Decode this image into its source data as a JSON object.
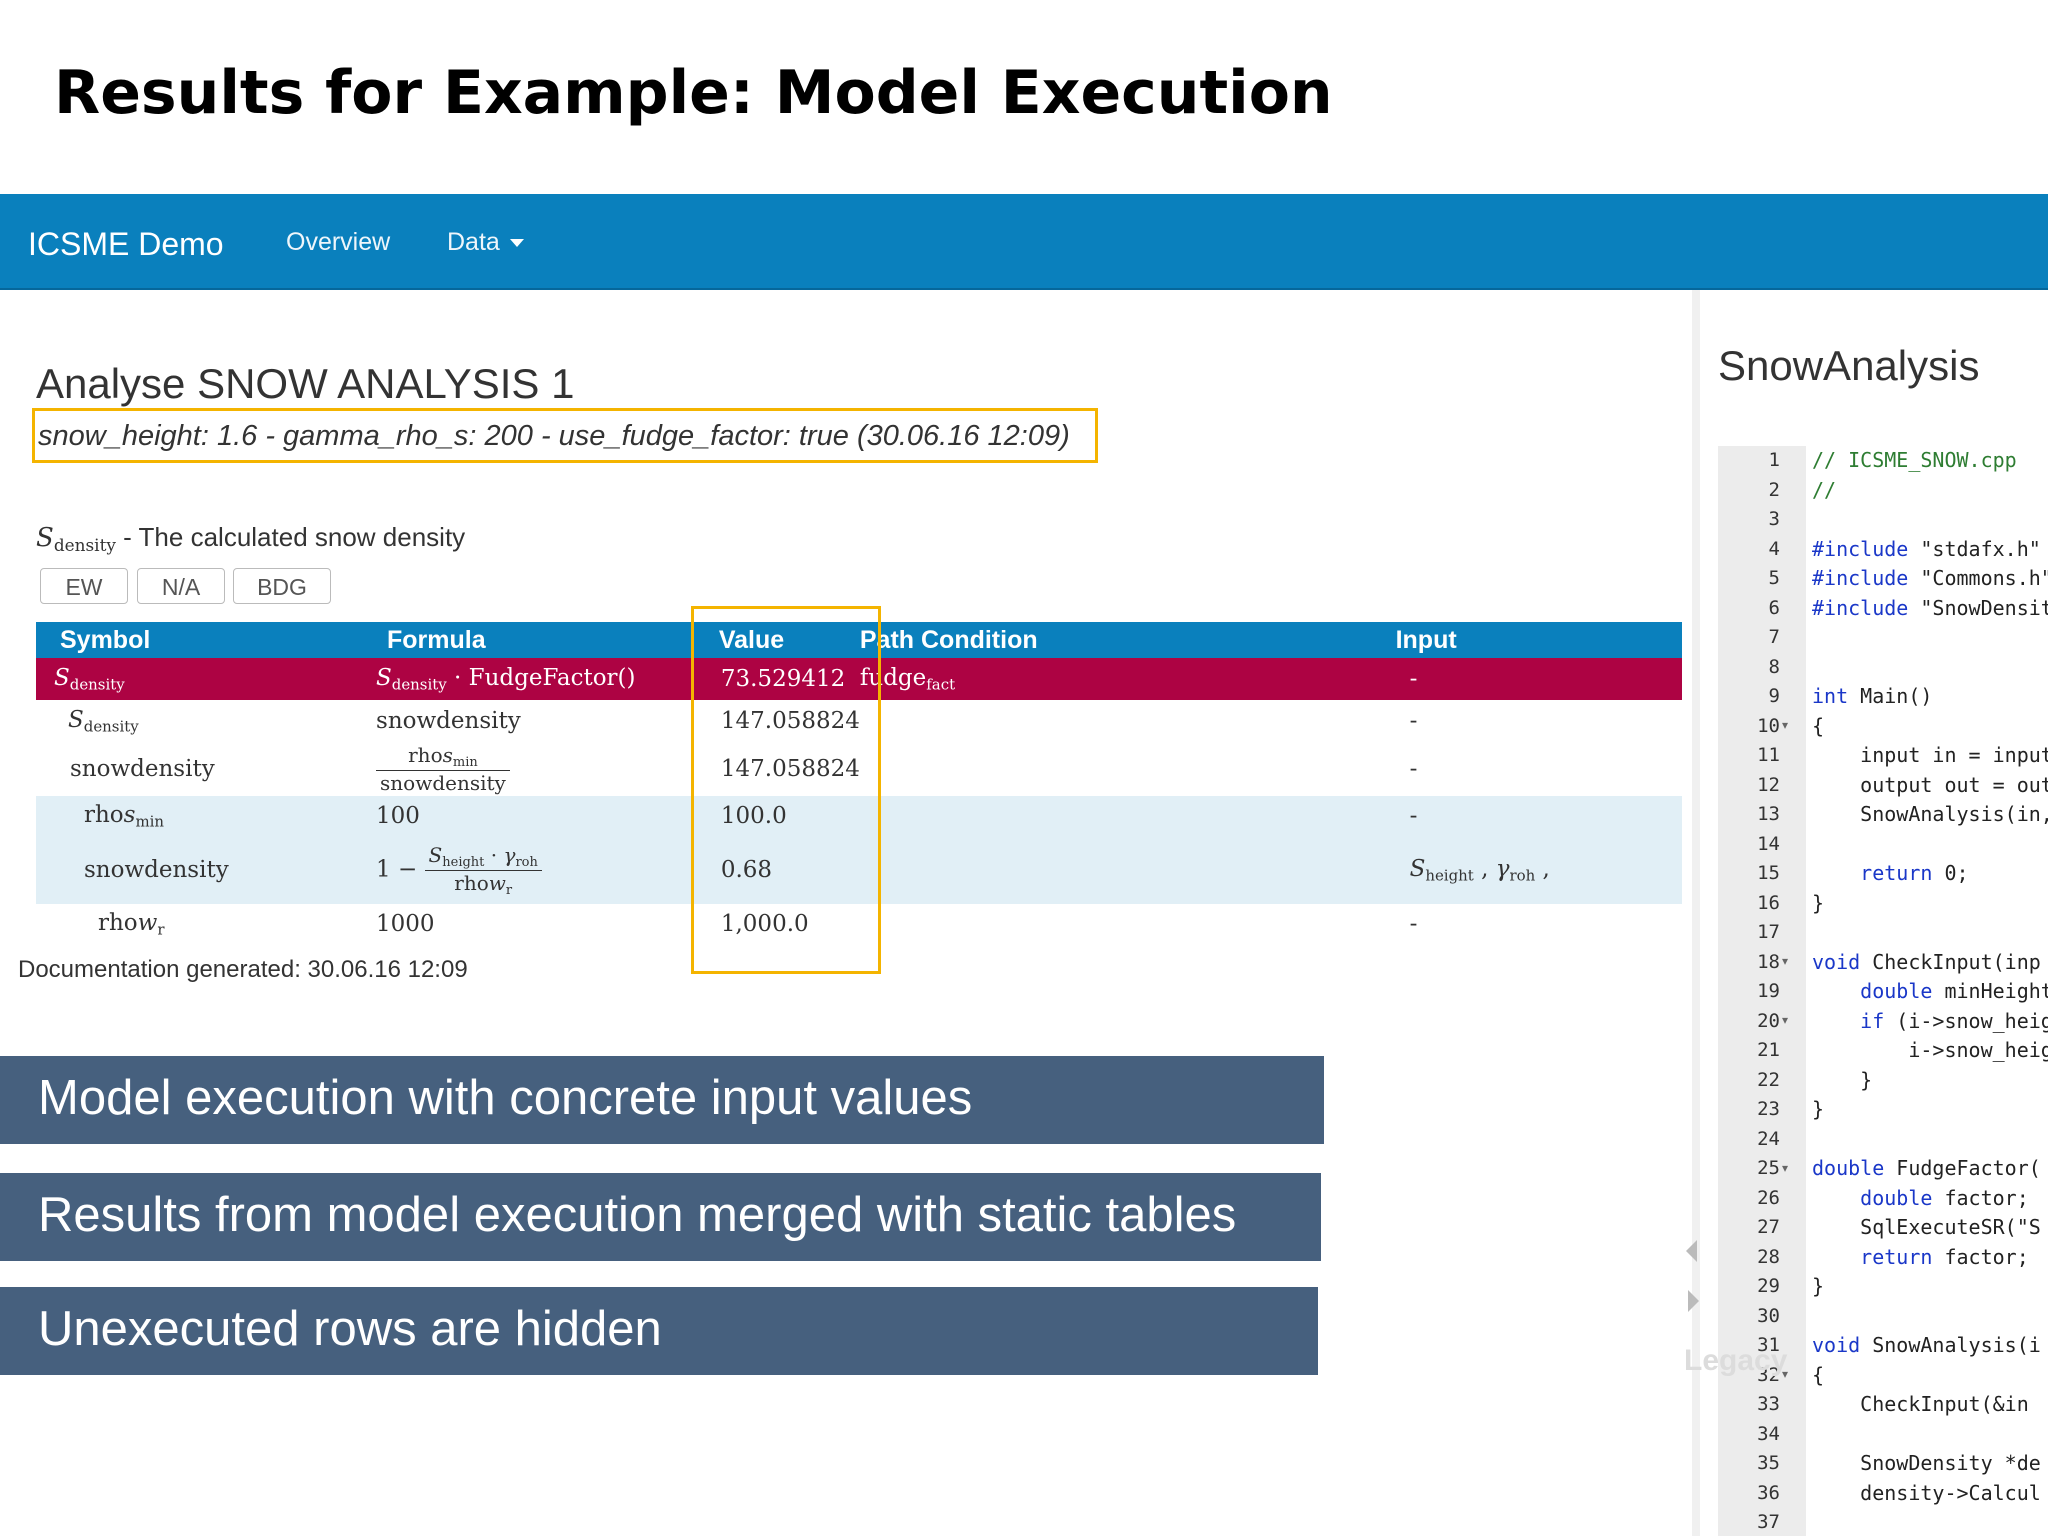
{
  "slide": {
    "title": "Results for Example: Model Execution"
  },
  "navbar": {
    "brand": "ICSME Demo",
    "items": [
      "Overview",
      "Data"
    ]
  },
  "analysis": {
    "title": "Analyse SNOW ANALYSIS 1",
    "params": "snow_height: 1.6 - gamma_rho_s: 200 - use_fudge_factor: true (30.06.16 12:09)",
    "symbol_desc": "- The calculated snow density",
    "buttons": [
      "EW",
      "N/A",
      "BDG"
    ]
  },
  "table": {
    "headers": [
      "Symbol",
      "Formula",
      "Value",
      "Path Condition",
      "Input"
    ],
    "rows": [
      {
        "value": "73.529412",
        "input": "-"
      },
      {
        "formula": "snowdensity",
        "value": "147.058824",
        "input": "-"
      },
      {
        "symbol": "snowdensity",
        "value": "147.058824",
        "input": "-",
        "frac_den": "snowdensity"
      },
      {
        "formula": "100",
        "value": "100.0",
        "input": "-"
      },
      {
        "symbol": "snowdensity",
        "value": "0.68"
      },
      {
        "formula": "1000",
        "value": "1,000.0",
        "input": "-"
      }
    ]
  },
  "doc_generated": "Documentation generated: 30.06.16 12:09",
  "banners": [
    "Model execution with concrete input values",
    "Results from model execution merged with static tables",
    "Unexecuted rows are hidden"
  ],
  "code_panel": {
    "title": "SnowAnalysis",
    "lines": [
      "1",
      "2",
      "3",
      "4",
      "5",
      "6",
      "7",
      "8",
      "9",
      "10",
      "11",
      "12",
      "13",
      "14",
      "15",
      "16",
      "17",
      "18",
      "19",
      "20",
      "21",
      "22",
      "23",
      "24",
      "25",
      "26",
      "27",
      "28",
      "29",
      "30",
      "31",
      "32",
      "33",
      "34",
      "35",
      "36",
      "37"
    ],
    "code": {
      "l1": "// ICSME_SNOW.cpp",
      "l2": "//",
      "l4a": "#include",
      "l4b": " \"stdafx.h\"",
      "l5a": "#include",
      "l5b": " \"Commons.h\"",
      "l6a": "#include",
      "l6b": " \"SnowDensity.h\"",
      "l9a": "int",
      "l9b": " Main()",
      "l10": "{",
      "l11": "    input in = input",
      "l12": "    output out = out",
      "l13": "    SnowAnalysis(in,",
      "l15a": "    return",
      "l15b": " 0;",
      "l16": "}",
      "l18a": "void",
      "l18b": " CheckInput(inp",
      "l19a": "    double",
      "l19b": " minHeight",
      "l20a": "    if",
      "l20b": " (i->snow_heig",
      "l21": "        i->snow_heig",
      "l22": "    }",
      "l23": "}",
      "l25a": "double",
      "l25b": " FudgeFactor(",
      "l26a": "    double",
      "l26b": " factor;",
      "l27": "    SqlExecuteSR(\"S",
      "l28a": "    return",
      "l28b": " factor;",
      "l29": "}",
      "l31a": "void",
      "l31b": " SnowAnalysis(i",
      "l32": "{",
      "l33": "    CheckInput(&in",
      "l35": "    SnowDensity *de",
      "l36": "    density->Calcul"
    }
  },
  "watermark": "Legacy",
  "colors": {
    "nav": "#0a80bd",
    "active_row": "#ad0343",
    "info_row": "#e1eff6",
    "banner": "#46607e",
    "highlight": "#f4b400"
  }
}
